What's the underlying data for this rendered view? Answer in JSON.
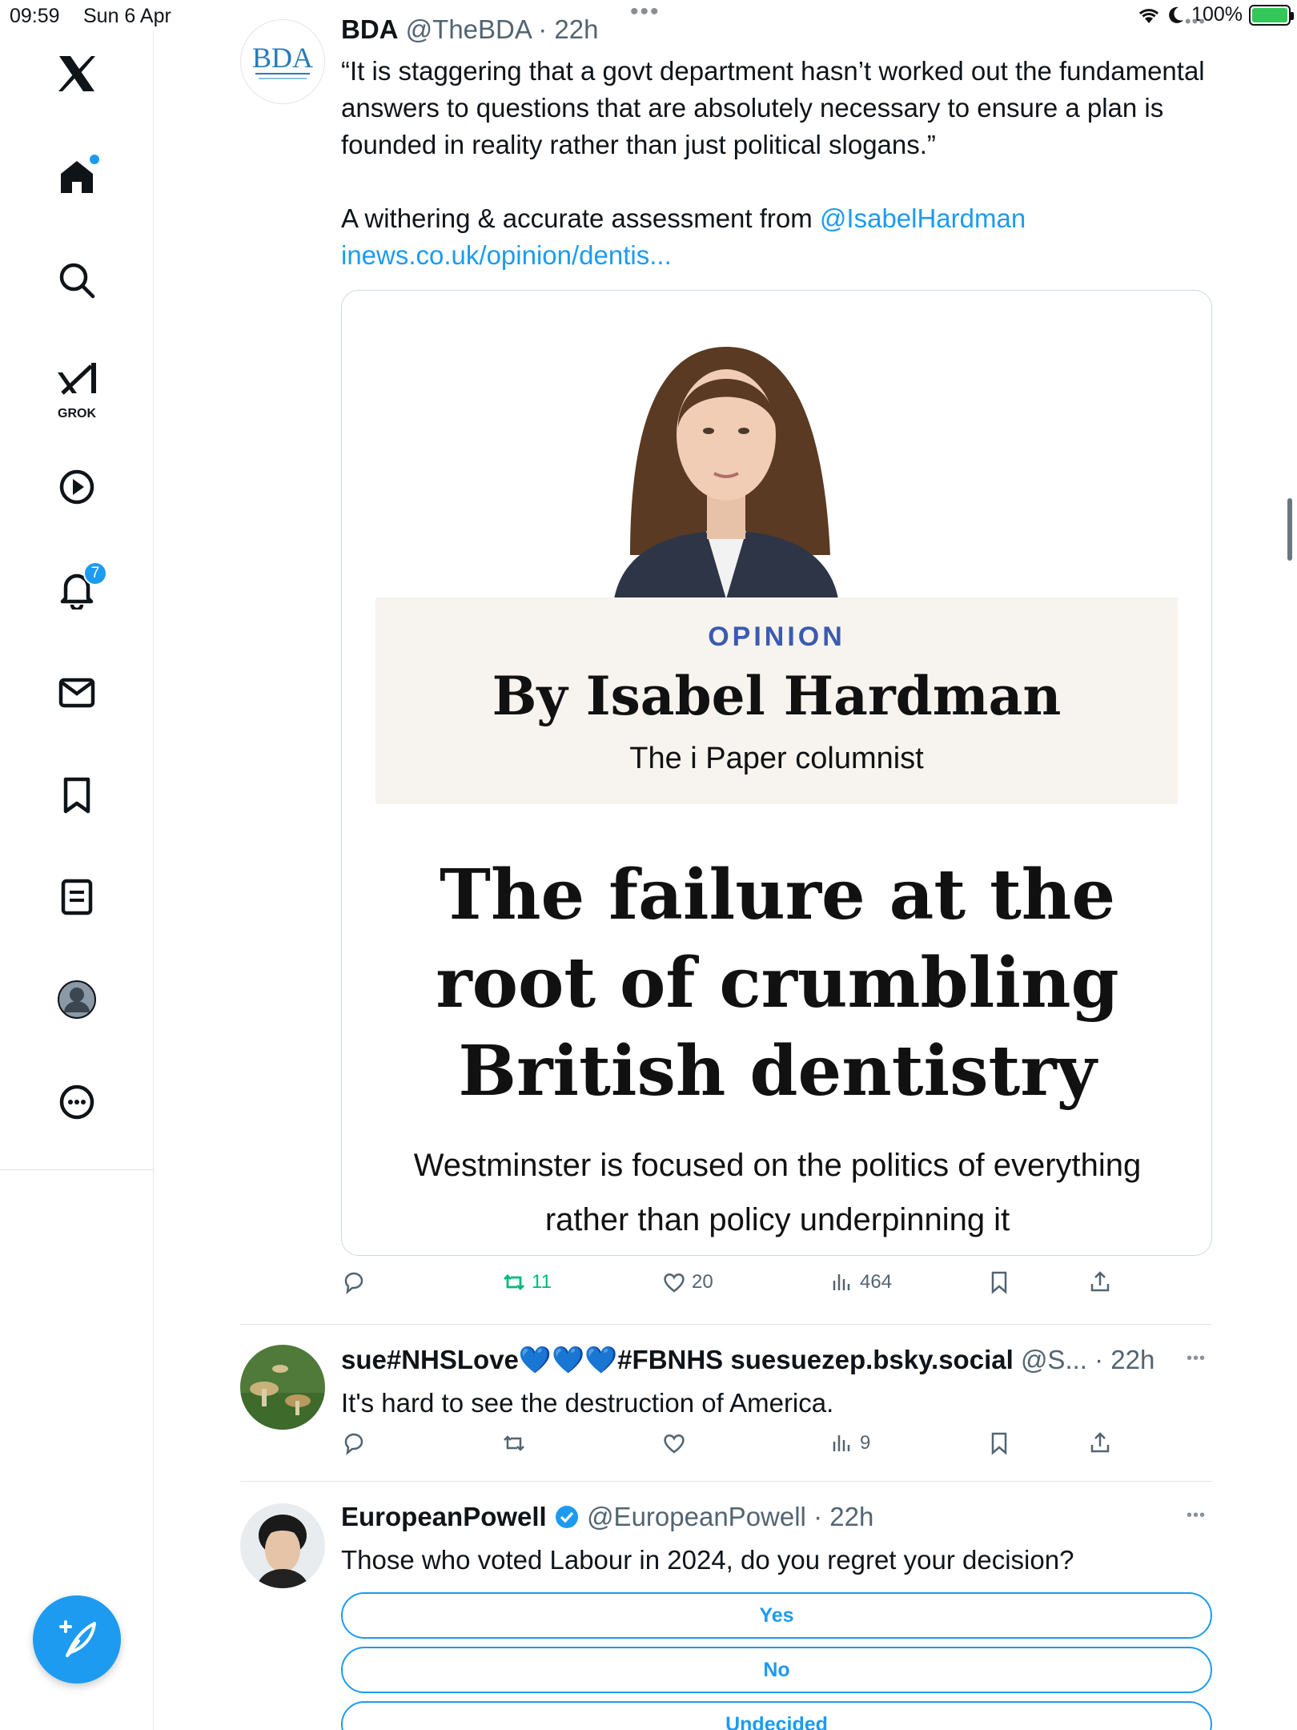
{
  "status_bar": {
    "time": "09:59",
    "date": "Sun 6 Apr",
    "battery": "100%"
  },
  "sidebar": {
    "items": [
      {
        "icon": "x-logo-icon"
      },
      {
        "icon": "home-icon"
      },
      {
        "icon": "search-icon"
      },
      {
        "icon": "grok-icon",
        "label": "GROK"
      },
      {
        "icon": "video-icon"
      },
      {
        "icon": "notifications-icon",
        "badge": "7"
      },
      {
        "icon": "messages-icon"
      },
      {
        "icon": "bookmarks-icon"
      },
      {
        "icon": "lists-icon"
      },
      {
        "icon": "profile-icon"
      },
      {
        "icon": "more-icon"
      }
    ],
    "compose_icon": "compose-icon"
  },
  "tweets": [
    {
      "avatar_text": "BDA",
      "name": "BDA",
      "handle": "@TheBDA",
      "time": "22h",
      "text_quote": "“It is staggering that a govt department hasn’t worked out the fundamental answers to questions that are absolutely necessary to ensure a plan is founded in reality rather than just political slogans.”",
      "text_prefix": "A withering & accurate assessment from ",
      "mention": "@IsabelHardman",
      "link": "inews.co.uk/opinion/dentis...",
      "card": {
        "label": "OPINION",
        "byline": "By Isabel Hardman",
        "role": "The i Paper columnist",
        "headline": "The failure at the root of crumbling British dentistry",
        "standfirst": "Westminster is focused on the politics of everything rather than policy underpinning it"
      },
      "actions": {
        "retweets": "11",
        "likes": "20",
        "views": "464"
      }
    },
    {
      "name": "sue#NHSLove💙💙💙#FBNHS suesuezep.bsky.social",
      "handle": "@S...",
      "time": "22h",
      "text": "It's hard to see the destruction of America.",
      "actions": {
        "views": "9"
      }
    },
    {
      "name": "EuropeanPowell",
      "handle": "@EuropeanPowell",
      "time": "22h",
      "text": "Those who voted Labour in 2024, do you regret your decision?",
      "poll": [
        "Yes",
        "No",
        "Undecided"
      ]
    }
  ],
  "colors": {
    "accent": "#1d9bf0",
    "retweet_green": "#00ba7c",
    "opinion_blue": "#3a5bb0",
    "muted": "#536471"
  }
}
